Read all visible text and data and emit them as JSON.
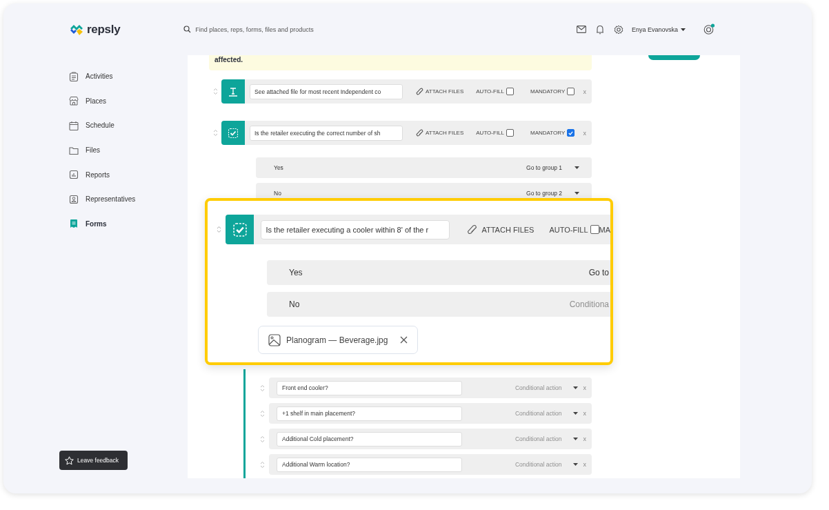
{
  "brand": {
    "name": "repsly"
  },
  "search": {
    "placeholder": "Find places, reps, forms, files and products"
  },
  "user": {
    "name": "Enya Evanovska"
  },
  "sidebar": {
    "items": [
      {
        "label": "Activities",
        "selected": false
      },
      {
        "label": "Places",
        "selected": false
      },
      {
        "label": "Schedule",
        "selected": false
      },
      {
        "label": "Files",
        "selected": false
      },
      {
        "label": "Reports",
        "selected": false
      },
      {
        "label": "Representatives",
        "selected": false
      },
      {
        "label": "Forms",
        "selected": true
      }
    ]
  },
  "feedback_button": {
    "label": "Leave feedback"
  },
  "notice": {
    "text": "affected."
  },
  "questions": [
    {
      "kind": "text",
      "value": "See attached file for most recent Independent co",
      "attach_label": "ATTACH FILES",
      "autofill_label": "AUTO-FILL",
      "autofill_checked": false,
      "mandatory_label": "MANDATORY",
      "mandatory_checked": false,
      "delete_label": "x"
    },
    {
      "kind": "checkbox",
      "value": "Is the retailer executing the correct number of sh",
      "attach_label": "ATTACH FILES",
      "autofill_label": "AUTO-FILL",
      "autofill_checked": false,
      "mandatory_label": "MANDATORY",
      "mandatory_checked": true,
      "delete_label": "x",
      "options": [
        {
          "label": "Yes",
          "action": "Go to group 1"
        },
        {
          "label": "No",
          "action": "Go to group 2"
        }
      ]
    }
  ],
  "highlight": {
    "kind": "checkbox",
    "value": "Is the retailer executing a cooler within 8' of the r",
    "attach_label": "ATTACH FILES",
    "autofill_label": "AUTO-FILL",
    "autofill_checked": false,
    "mandatory_label": "MA",
    "options": [
      {
        "label": "Yes",
        "action": "Go to"
      },
      {
        "label": "No",
        "action_placeholder": "Conditiona"
      }
    ],
    "attachment": {
      "name": "Planogram — Beverage.jpg"
    }
  },
  "sub_questions": [
    {
      "value": "Front end cooler?",
      "action_placeholder": "Conditional action",
      "delete_label": "x"
    },
    {
      "value": "+1 shelf in main placement?",
      "action_placeholder": "Conditional action",
      "delete_label": "x"
    },
    {
      "value": "Additional Cold placement?",
      "action_placeholder": "Conditional action",
      "delete_label": "x"
    },
    {
      "value": "Additional Warm location?",
      "action_placeholder": "Conditional action",
      "delete_label": "x"
    }
  ]
}
